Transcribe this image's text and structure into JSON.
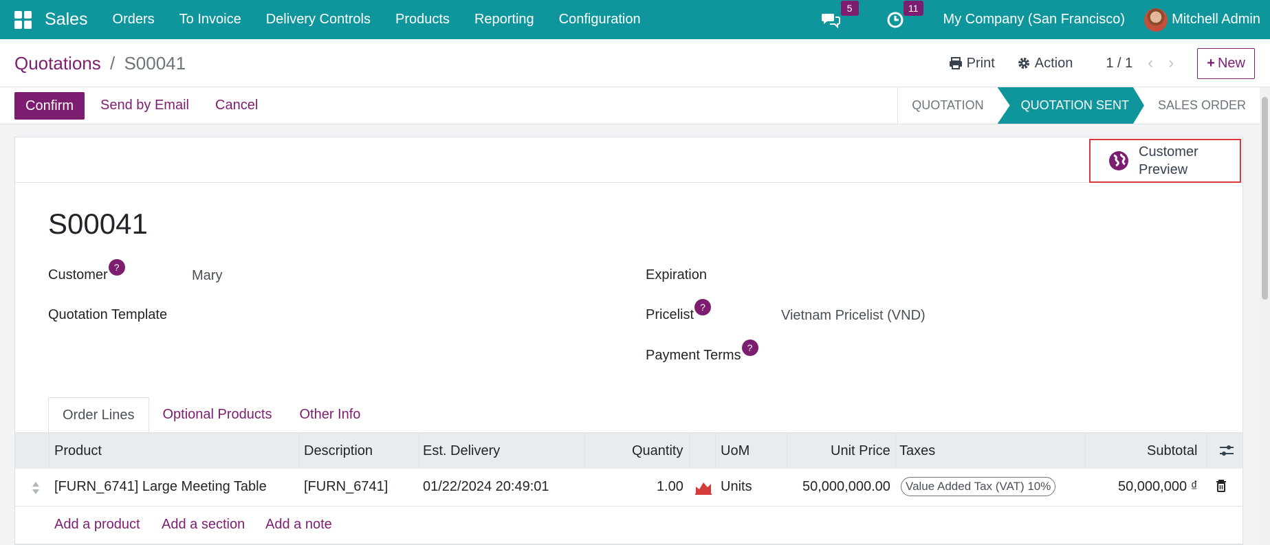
{
  "navbar": {
    "brand": "Sales",
    "menu": [
      "Orders",
      "To Invoice",
      "Delivery Controls",
      "Products",
      "Reporting",
      "Configuration"
    ],
    "messages_count": "5",
    "activities_count": "11",
    "company": "My Company (San Francisco)",
    "user": "Mitchell Admin"
  },
  "breadcrumb": {
    "parent": "Quotations",
    "separator": "/",
    "current": "S00041"
  },
  "control": {
    "print": "Print",
    "action": "Action",
    "pager": "1 / 1",
    "new": "New"
  },
  "actions": {
    "confirm": "Confirm",
    "send_email": "Send by Email",
    "cancel": "Cancel"
  },
  "stages": [
    "QUOTATION",
    "QUOTATION SENT",
    "SALES ORDER"
  ],
  "active_stage": "QUOTATION SENT",
  "preview_button": {
    "line1": "Customer",
    "line2": "Preview"
  },
  "record": {
    "name": "S00041",
    "customer_label": "Customer",
    "customer_value": "Mary",
    "template_label": "Quotation Template",
    "expiration_label": "Expiration",
    "pricelist_label": "Pricelist",
    "pricelist_value": "Vietnam Pricelist (VND)",
    "payment_terms_label": "Payment Terms",
    "help_mark": "?"
  },
  "tabs": [
    "Order Lines",
    "Optional Products",
    "Other Info"
  ],
  "table": {
    "columns": [
      "Product",
      "Description",
      "Est. Delivery",
      "Quantity",
      "UoM",
      "Unit Price",
      "Taxes",
      "Subtotal"
    ],
    "rows": [
      {
        "product": "[FURN_6741] Large Meeting Table",
        "description": "[FURN_6741]",
        "delivery": "01/22/2024 20:49:01",
        "quantity": "1.00",
        "uom": "Units",
        "unit_price": "50,000,000.00",
        "tax": "Value Added Tax (VAT) 10%",
        "subtotal": "50,000,000 ₫"
      }
    ],
    "add_links": [
      "Add a product",
      "Add a section",
      "Add a note"
    ]
  },
  "colors": {
    "primary": "#7c1d6f",
    "navbar": "#0f969c",
    "highlight_box": "#d9363e"
  }
}
